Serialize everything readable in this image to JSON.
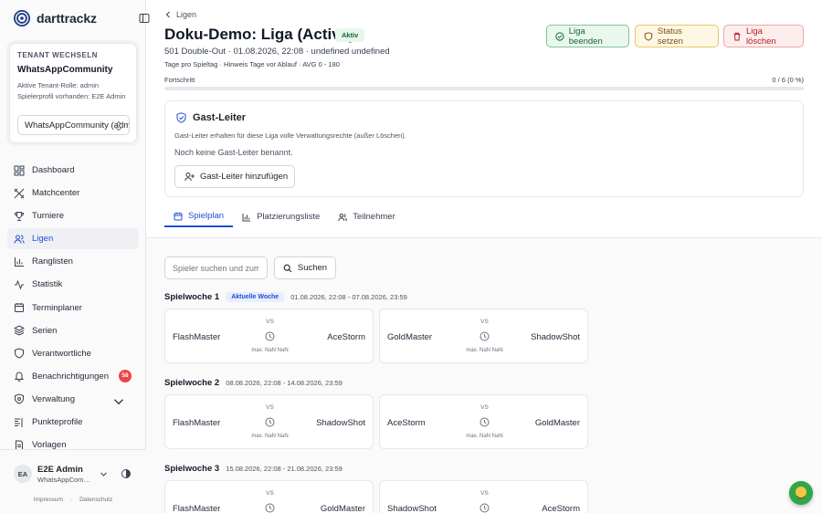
{
  "app": {
    "name": "darttrackz"
  },
  "tenant": {
    "title": "TENANT WECHSELN",
    "name": "WhatsAppCommunity",
    "role": "Aktive Tenant-Rolle: admin",
    "profile": "Spielerprofil vorhanden: E2E Admin",
    "select_value": "WhatsAppCommunity (admin)"
  },
  "nav": {
    "items": [
      {
        "label": "Dashboard",
        "icon": "dashboard-icon"
      },
      {
        "label": "Matchcenter",
        "icon": "crossed-darts-icon"
      },
      {
        "label": "Turniere",
        "icon": "trophy-icon"
      },
      {
        "label": "Ligen",
        "icon": "users-icon"
      },
      {
        "label": "Ranglisten",
        "icon": "bar-chart-icon"
      },
      {
        "label": "Statistik",
        "icon": "activity-icon"
      },
      {
        "label": "Terminplaner",
        "icon": "calendar-icon"
      },
      {
        "label": "Serien",
        "icon": "layers-icon"
      },
      {
        "label": "Verantwortliche",
        "icon": "shield-icon"
      },
      {
        "label": "Benachrichtigungen",
        "icon": "bell-icon"
      },
      {
        "label": "Verwaltung",
        "icon": "settings-icon"
      },
      {
        "label": "Punkteprofile",
        "icon": "list-icon"
      },
      {
        "label": "Vorlagen",
        "icon": "document-icon"
      }
    ],
    "notification_count": "58"
  },
  "user": {
    "initials": "EA",
    "name": "E2E Admin",
    "tenant": "WhatsAppCommunity"
  },
  "footer": {
    "impressum": "Impressum",
    "datenschutz": "Datenschutz"
  },
  "header": {
    "breadcrumb": "Ligen",
    "title": "Doku-Demo: Liga (Active)",
    "status": "Aktiv",
    "subtitle": "501 Double-Out · 01.08.2026, 22:08 · undefined undefined",
    "meta": "Tage pro Spieltag · Hinweis Tage vor Ablauf · AVG 0 - 180"
  },
  "actions": {
    "end": "Liga beenden",
    "status": "Status setzen",
    "delete": "Liga löschen"
  },
  "progress": {
    "label": "Fortschritt",
    "value_text": "0 / 6 (0 %)",
    "fraction": 0
  },
  "guest": {
    "title": "Gast-Leiter",
    "description": "Gast-Leiter erhalten für diese Liga volle Verwaltungsrechte (außer Löschen).",
    "empty": "Noch keine Gast-Leiter benannt.",
    "add": "Gast-Leiter hinzufügen"
  },
  "tabs": [
    "Spielplan",
    "Platzierungsliste",
    "Teilnehmer"
  ],
  "search": {
    "placeholder": "Spieler suchen und zum",
    "button": "Suchen"
  },
  "match_labels": {
    "vs": "VS",
    "max": "max. NaN NaN"
  },
  "weeks": [
    {
      "title": "Spielwoche 1",
      "badge": "Aktuelle Woche",
      "dates": "01.08.2026, 22:08 - 07.08.2026, 23:59",
      "matches": [
        {
          "home": "FlashMaster",
          "away": "AceStorm"
        },
        {
          "home": "GoldMaster",
          "away": "ShadowShot"
        }
      ]
    },
    {
      "title": "Spielwoche 2",
      "badge": "",
      "dates": "08.08.2026, 22:08 - 14.08.2026, 23:59",
      "matches": [
        {
          "home": "FlashMaster",
          "away": "ShadowShot"
        },
        {
          "home": "AceStorm",
          "away": "GoldMaster"
        }
      ]
    },
    {
      "title": "Spielwoche 3",
      "badge": "",
      "dates": "15.08.2026, 22:08 - 21.08.2026, 23:59",
      "matches": [
        {
          "home": "FlashMaster",
          "away": "GoldMaster"
        },
        {
          "home": "ShadowShot",
          "away": "AceStorm"
        }
      ]
    }
  ],
  "colors": {
    "accent": "#1d4ed8",
    "success": "#166534",
    "warning": "#854d0e",
    "danger": "#b91c1c",
    "badge_red": "#ef4444"
  }
}
